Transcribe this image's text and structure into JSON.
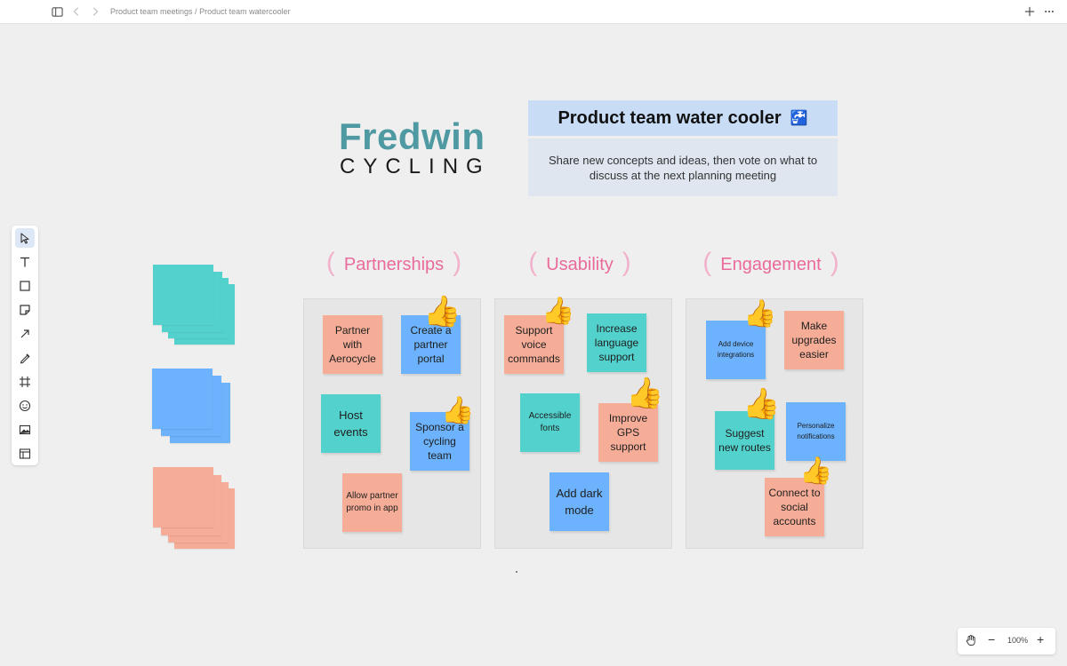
{
  "topbar": {
    "breadcrumb_parent": "Product team meetings",
    "breadcrumb_sep": " / ",
    "breadcrumb_current": "Product team watercooler",
    "icons": [
      "sidebar-toggle-icon",
      "back-arrow-icon",
      "forward-arrow-icon",
      "plus-icon",
      "more-icon"
    ]
  },
  "toolbar": {
    "tools": [
      "select-tool",
      "text-tool",
      "shape-tool",
      "sticky-note-tool",
      "arrow-tool",
      "pen-tool",
      "frame-tool",
      "emoji-tool",
      "image-tool",
      "template-tool"
    ],
    "active": "select-tool"
  },
  "header": {
    "logo_top": "Fredwin",
    "logo_bottom": "CYCLING",
    "title": "Product team water cooler",
    "title_emoji": "🚰",
    "description": "Share new concepts and ideas, then vote on what to discuss at the next planning meeting"
  },
  "colors": {
    "teal": "#53d2cd",
    "blue": "#6cb2fc",
    "salmon": "#f6ad98",
    "header_pink": "#ea6a9b",
    "logo_teal": "#4f9aa2"
  },
  "columns": [
    {
      "title": "Partnerships",
      "notes": [
        {
          "text": "Partner with Aerocycle",
          "color": "salmon",
          "votes": 0
        },
        {
          "text": "Create a partner portal",
          "color": "blue",
          "votes": 1
        },
        {
          "text": "Host events",
          "color": "teal",
          "votes": 0
        },
        {
          "text": "Sponsor a cycling team",
          "color": "blue",
          "votes": 1
        },
        {
          "text": "Allow partner promo in app",
          "color": "salmon",
          "votes": 0
        }
      ]
    },
    {
      "title": "Usability",
      "notes": [
        {
          "text": "Support voice commands",
          "color": "salmon",
          "votes": 1
        },
        {
          "text": "Increase language support",
          "color": "teal",
          "votes": 0
        },
        {
          "text": "Accessible fonts",
          "color": "teal",
          "votes": 0
        },
        {
          "text": "Improve GPS support",
          "color": "salmon",
          "votes": 2
        },
        {
          "text": "Add dark mode",
          "color": "blue",
          "votes": 0
        }
      ]
    },
    {
      "title": "Engagement",
      "notes": [
        {
          "text": "Add device integrations",
          "color": "blue",
          "votes": 1
        },
        {
          "text": "Make upgrades easier",
          "color": "salmon",
          "votes": 0
        },
        {
          "text": "Suggest new routes",
          "color": "teal",
          "votes": 2
        },
        {
          "text": "Personalize notifications",
          "color": "blue",
          "votes": 0
        },
        {
          "text": "Connect to social accounts",
          "color": "salmon",
          "votes": 1
        }
      ]
    }
  ],
  "vote_emoji": "👍",
  "zoom": {
    "value": "100%",
    "minus": "−",
    "plus": "+"
  }
}
